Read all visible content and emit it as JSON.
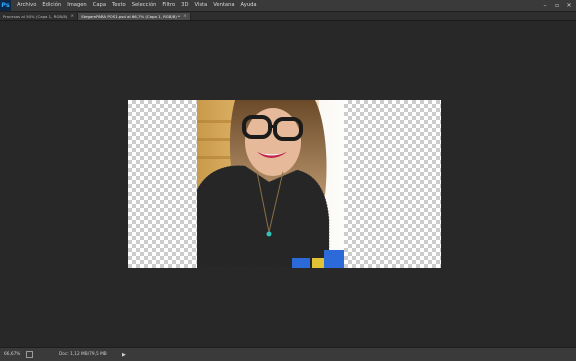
{
  "app": {
    "logo": "Ps"
  },
  "menubar": {
    "items": [
      "Archivo",
      "Edición",
      "Imagen",
      "Capa",
      "Texto",
      "Selección",
      "Filtro",
      "3D",
      "Vista",
      "Ventana",
      "Ayuda"
    ]
  },
  "window_controls": {
    "minimize": "–",
    "restore": "▫",
    "close": "✕"
  },
  "tabs": [
    {
      "label": "Procesos al 50% (Capa 1, RGB/8)",
      "close": "×",
      "active": false
    },
    {
      "label": "StegamPARA POS1.psd al 66,7% (Capa 1, RGB/8) *",
      "close": "×",
      "active": true
    }
  ],
  "statusbar": {
    "zoom": "66,67%",
    "doc_info": "Doc: 1,12 MB/79,5 MB",
    "arrow": "▶"
  },
  "colors": {
    "workspace": "#282828",
    "menubar": "#3a3a3a",
    "accent": "#31a8ff"
  }
}
